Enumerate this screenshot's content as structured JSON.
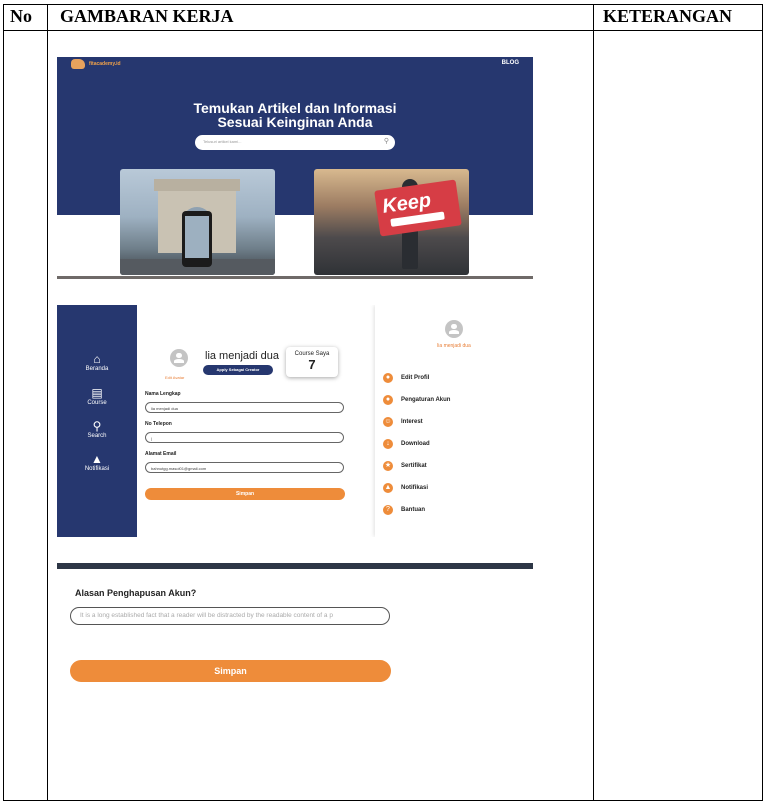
{
  "table": {
    "headers": {
      "no": "No",
      "work": "GAMBARAN KERJA",
      "notes": "KETERANGAN"
    }
  },
  "blog": {
    "logo_text": "fitacademy.id",
    "nav_link": "BLOG",
    "hero_title_line1": "Temukan Artikel dan Informasi",
    "hero_title_line2": "Sesuai Keinginan Anda",
    "search_placeholder": "Telusuri artikel kami...",
    "card2_word": "Keep",
    "colors": {
      "hero": "#26376f",
      "accent": "#f0a24a"
    }
  },
  "profile": {
    "sidebar": [
      {
        "icon": "home-icon",
        "label": "Beranda"
      },
      {
        "icon": "book-icon",
        "label": "Course"
      },
      {
        "icon": "search-icon",
        "label": "Search"
      },
      {
        "icon": "bell-icon",
        "label": "Notifikasi"
      }
    ],
    "user_name": "lia menjadi dua",
    "edit_photo": "Edit Avatar",
    "apply_label": "Apply Sebagai Creator",
    "course_title": "Course Saya",
    "course_count": "7",
    "fields": [
      {
        "label": "Nama Lengkap",
        "value": "lia menjadi dua"
      },
      {
        "label": "No Telepon",
        "value": "|"
      },
      {
        "label": "Alamat Email",
        "value": "bahnutgg.masol01@gmail.com"
      }
    ],
    "save_label": "Simpan",
    "menu_name": "lia menjadi dua",
    "menu": [
      {
        "icon": "edit-profile-icon",
        "label": "Edit Profil"
      },
      {
        "icon": "account-settings-icon",
        "label": "Pengaturan Akun"
      },
      {
        "icon": "interest-icon",
        "label": "Interest"
      },
      {
        "icon": "download-icon",
        "label": "Download"
      },
      {
        "icon": "certificate-icon",
        "label": "Sertifikat"
      },
      {
        "icon": "notification-icon",
        "label": "Notifikasi"
      },
      {
        "icon": "help-icon",
        "label": "Bantuan"
      }
    ],
    "colors": {
      "sidebar": "#26376f",
      "button": "#ee8c3a"
    }
  },
  "delete_account": {
    "title": "Alasan Penghapusan Akun?",
    "input_placeholder": "It is a long established fact that a reader will be distracted by the readable content of a p",
    "save_label": "Simpan"
  }
}
